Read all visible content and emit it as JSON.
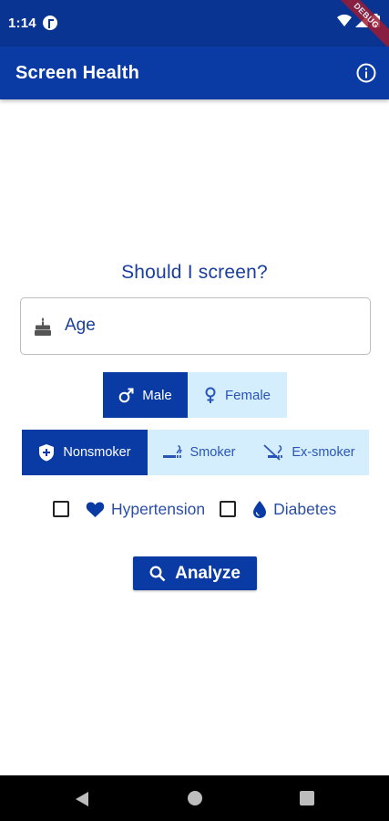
{
  "status_bar": {
    "time": "1:14",
    "notification_icon": "app-notification-icon",
    "wifi_icon": "wifi-icon",
    "signal_icon": "cell-signal-icon",
    "battery_icon": "battery-icon"
  },
  "debug_banner": "DEBUG",
  "app_bar": {
    "title": "Screen Health",
    "info_icon": "info-icon"
  },
  "form": {
    "heading": "Should I screen?",
    "age": {
      "placeholder": "Age",
      "value": "",
      "icon": "cake-icon"
    },
    "gender": {
      "options": [
        {
          "label": "Male",
          "icon": "male-symbol-icon",
          "selected": true
        },
        {
          "label": "Female",
          "icon": "female-symbol-icon",
          "selected": false
        }
      ]
    },
    "smoking": {
      "options": [
        {
          "label": "Nonsmoker",
          "icon": "shield-plus-icon",
          "selected": true
        },
        {
          "label": "Smoker",
          "icon": "smoking-icon",
          "selected": false
        },
        {
          "label": "Ex-smoker",
          "icon": "smoke-free-icon",
          "selected": false
        }
      ]
    },
    "conditions": [
      {
        "label": "Hypertension",
        "icon": "heart-icon",
        "checked": false
      },
      {
        "label": "Diabetes",
        "icon": "water-drop-icon",
        "checked": false
      }
    ],
    "analyze_label": "Analyze",
    "analyze_icon": "search-icon"
  },
  "nav_bar": {
    "back_icon": "back-triangle-icon",
    "home_icon": "home-circle-icon",
    "recent_icon": "recent-square-icon"
  },
  "colors": {
    "primary": "#0a3ba4",
    "status_bar": "#0a3491",
    "selected_segment": "#0a3ba4",
    "unselected_segment": "#d4eefe",
    "text_primary": "#1a3e9c"
  }
}
